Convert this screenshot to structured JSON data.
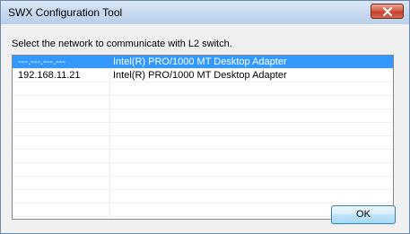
{
  "window": {
    "title": "SWX Configuration Tool"
  },
  "dialog": {
    "instruction": "Select the network to communicate with L2 switch.",
    "ok_label": "OK"
  },
  "networks": [
    {
      "ip": "---.---.---.---",
      "adapter": "Intel(R) PRO/1000 MT Desktop Adapter",
      "selected": true
    },
    {
      "ip": "192.168.11.21",
      "adapter": "Intel(R) PRO/1000 MT Desktop Adapter",
      "selected": false
    }
  ],
  "icons": {
    "close": "close-icon"
  },
  "colors": {
    "selection": "#3399ff",
    "close_button": "#c6412c"
  }
}
